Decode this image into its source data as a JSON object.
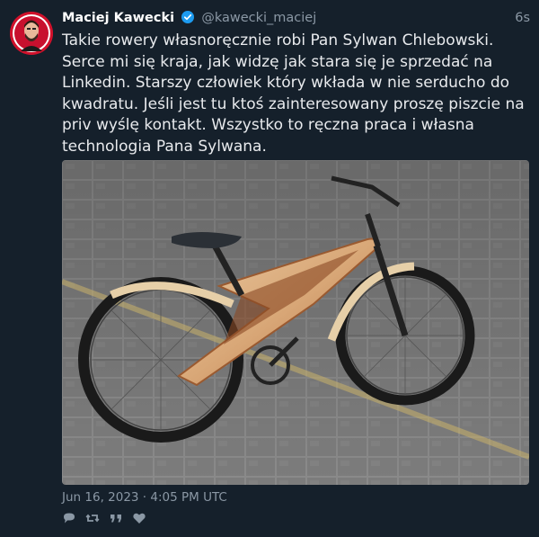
{
  "author": {
    "name": "Maciej Kawecki",
    "handle": "@kawecki_maciej",
    "verified": true
  },
  "tweet": {
    "relative_time": "6s",
    "text": "Takie rowery własnoręcznie robi Pan Sylwan Chlebowski. Serce mi się kraja, jak widzę jak stara się je sprzedać na Linkedin. Starszy człowiek który wkłada w nie serducho do kwadratu. Jeśli jest tu ktoś zainteresowany proszę piszcie na priv wyślę kontakt. Wszystko to ręczna praca i własna technologia Pana Sylwana.",
    "timestamp": "Jun 16, 2023 · 4:05 PM UTC",
    "media": {
      "alt": "wooden bicycle on pavement"
    }
  },
  "actions": [
    {
      "name": "reply",
      "icon": "reply-icon"
    },
    {
      "name": "retweet",
      "icon": "retweet-icon"
    },
    {
      "name": "quote",
      "icon": "quote-icon"
    },
    {
      "name": "like",
      "icon": "heart-icon"
    }
  ],
  "colors": {
    "background": "#15202b",
    "text": "#e8eaed",
    "muted": "#8b98a5",
    "verified": "#1d9bf0"
  }
}
